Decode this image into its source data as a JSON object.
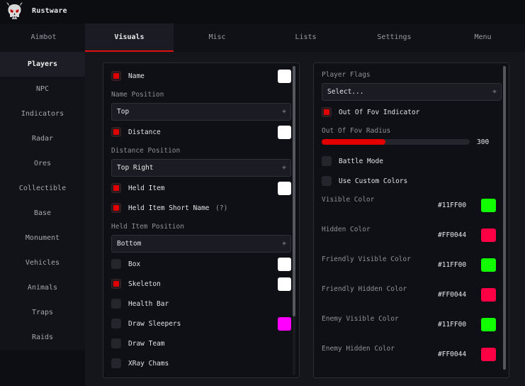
{
  "app": {
    "title": "Rustware"
  },
  "tabs": [
    {
      "label": "Aimbot",
      "active": false
    },
    {
      "label": "Visuals",
      "active": true
    },
    {
      "label": "Misc",
      "active": false
    },
    {
      "label": "Lists",
      "active": false
    },
    {
      "label": "Settings",
      "active": false
    },
    {
      "label": "Menu",
      "active": false
    }
  ],
  "sidebar": {
    "items": [
      {
        "label": "Players",
        "active": true
      },
      {
        "label": "NPC"
      },
      {
        "label": "Indicators"
      },
      {
        "label": "Radar"
      },
      {
        "label": "Ores"
      },
      {
        "label": "Collectible"
      },
      {
        "label": "Base"
      },
      {
        "label": "Monument"
      },
      {
        "label": "Vehicles"
      },
      {
        "label": "Animals"
      },
      {
        "label": "Traps"
      },
      {
        "label": "Raids"
      }
    ]
  },
  "left_panel": {
    "name": {
      "label": "Name",
      "checked": true,
      "color": "#FFFFFF"
    },
    "name_position": {
      "label": "Name Position",
      "value": "Top"
    },
    "distance": {
      "label": "Distance",
      "checked": true,
      "color": "#FFFFFF"
    },
    "distance_position": {
      "label": "Distance Position",
      "value": "Top Right"
    },
    "held_item": {
      "label": "Held Item",
      "checked": true,
      "color": "#FFFFFF"
    },
    "held_item_short": {
      "label": "Held Item Short Name",
      "hint": "(?)",
      "checked": true
    },
    "held_item_position": {
      "label": "Held Item Position",
      "value": "Bottom"
    },
    "box": {
      "label": "Box",
      "checked": false,
      "color": "#FFFFFF"
    },
    "skeleton": {
      "label": "Skeleton",
      "checked": true,
      "color": "#FFFFFF"
    },
    "health_bar": {
      "label": "Health Bar",
      "checked": false
    },
    "draw_sleepers": {
      "label": "Draw Sleepers",
      "checked": false,
      "color": "#FF00FF"
    },
    "draw_team": {
      "label": "Draw Team",
      "checked": false
    },
    "xray_chams": {
      "label": "XRay Chams",
      "checked": false
    },
    "plus_symbol": "+"
  },
  "right_panel": {
    "player_flags": {
      "label": "Player Flags",
      "placeholder": "Select..."
    },
    "out_of_fov_indicator": {
      "label": "Out Of Fov Indicator",
      "checked": true
    },
    "out_of_fov_radius": {
      "label": "Out Of Fov Radius",
      "value": "300",
      "fraction": 0.43
    },
    "battle_mode": {
      "label": "Battle Mode",
      "checked": false
    },
    "use_custom_colors": {
      "label": "Use Custom Colors",
      "checked": false
    },
    "colors": [
      {
        "label": "Visible Color",
        "hex": "#11FF00",
        "color": "#11FF00"
      },
      {
        "label": "Hidden Color",
        "hex": "#FF0044",
        "color": "#FF0044"
      },
      {
        "label": "Friendly Visible Color",
        "hex": "#11FF00",
        "color": "#11FF00"
      },
      {
        "label": "Friendly Hidden Color",
        "hex": "#FF0044",
        "color": "#FF0044"
      },
      {
        "label": "Enemy Visible Color",
        "hex": "#11FF00",
        "color": "#11FF00"
      },
      {
        "label": "Enemy Hidden Color",
        "hex": "#FF0044",
        "color": "#FF0044"
      }
    ]
  },
  "theme": {
    "accent": "#E00000"
  }
}
